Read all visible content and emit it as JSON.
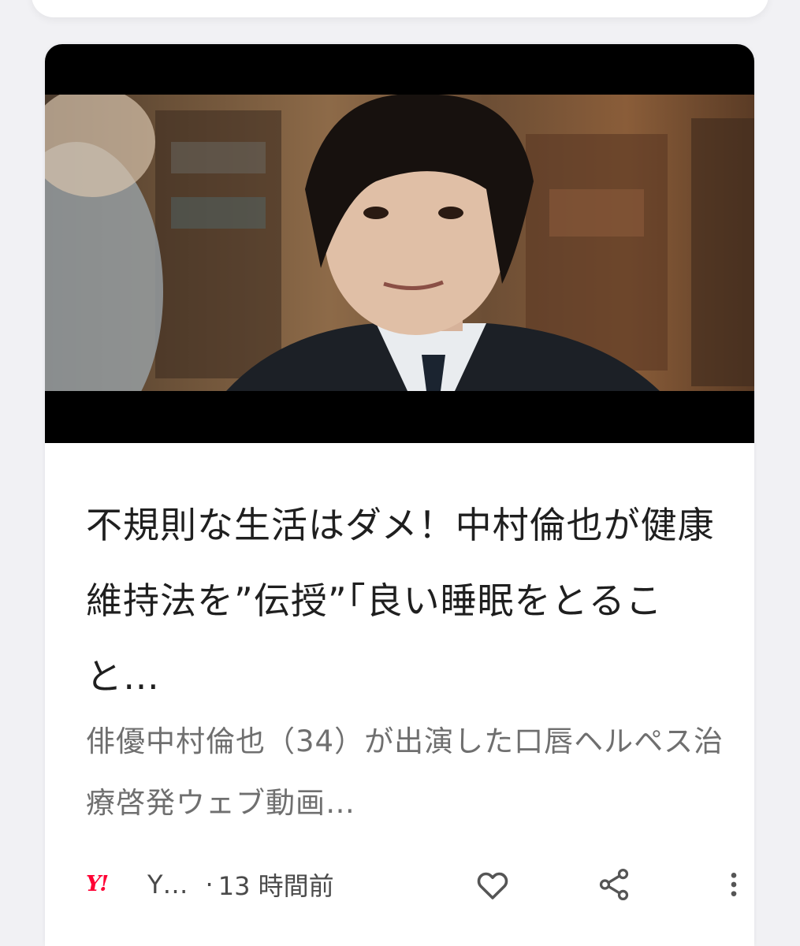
{
  "card": {
    "title": "不規則な生活はダメ！中村倫也が健康維持法を”伝授”「良い睡眠をとること…",
    "snippet": "俳優中村倫也（34）が出演した口唇ヘルペス治療啓発ウェブ動画…",
    "thumbnail": {
      "icon": "video-thumbnail-image"
    },
    "footer": {
      "source_logo": "Y!",
      "source_name": "Y…",
      "separator": "·",
      "time": "13 時間前",
      "like_icon": "heart-outline-icon",
      "share_icon": "share-icon",
      "more_icon": "more-vert-icon"
    }
  },
  "colors": {
    "background": "#f1f1f4",
    "card": "#ffffff",
    "title_text": "#1f1f1f",
    "snippet_text": "#6f6f6f",
    "meta_text": "#4a4a4a",
    "source_logo": "#ff0033"
  }
}
